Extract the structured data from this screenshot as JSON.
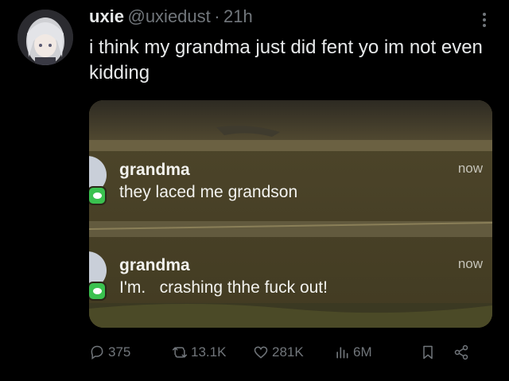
{
  "tweet": {
    "display_name": "uxie",
    "handle": "@uxiedust",
    "separator": "·",
    "time": "21h",
    "text": "i think my grandma just did fent yo im not even kidding"
  },
  "notifications": [
    {
      "title": "grandma",
      "body": "they laced me grandson",
      "time": "now"
    },
    {
      "title": "grandma",
      "body": "I'm.   crashing thhe fuck out!",
      "time": "now"
    }
  ],
  "actions": {
    "replies": "375",
    "retweets": "13.1K",
    "likes": "281K",
    "views": "6M"
  },
  "colors": {
    "background": "#000000",
    "text_primary": "#e7e9ea",
    "text_secondary": "#71767b",
    "notification_bg": "#4a4228",
    "messages_green": "#3ac14f"
  },
  "icons": [
    "more-icon",
    "reply-icon",
    "retweet-icon",
    "like-icon",
    "views-icon",
    "bookmark-icon",
    "share-icon",
    "messages-app-icon"
  ]
}
